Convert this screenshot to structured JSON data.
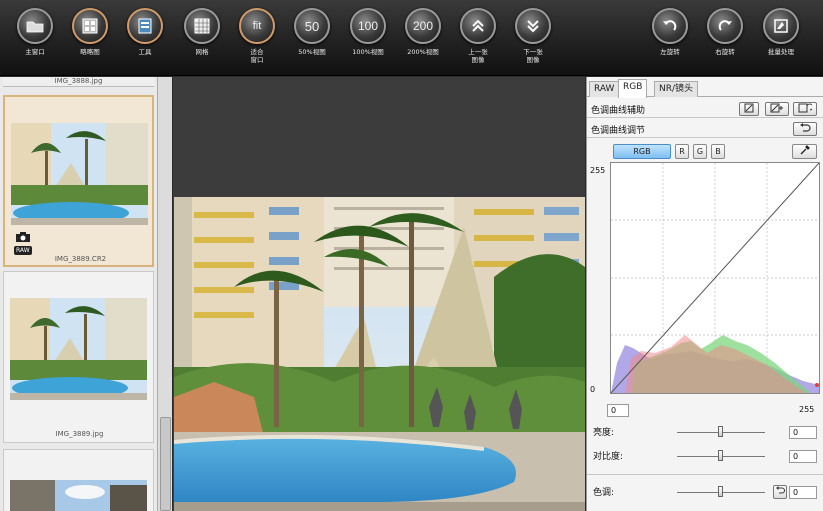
{
  "toolbar": {
    "buttons": [
      {
        "label": "主窗口",
        "glyph": ""
      },
      {
        "label": "略略图",
        "glyph": ""
      },
      {
        "label": "工具",
        "glyph": ""
      },
      {
        "label": "网格",
        "glyph": ""
      },
      {
        "label": "适合\n窗口",
        "glyph": "fit"
      },
      {
        "label": "50%视图",
        "glyph": "50"
      },
      {
        "label": "100%视图",
        "glyph": "100"
      },
      {
        "label": "200%视图",
        "glyph": "200"
      },
      {
        "label": "上一张\n图像",
        "glyph": ""
      },
      {
        "label": "下一张\n图像",
        "glyph": ""
      },
      {
        "label": "左旋转",
        "glyph": ""
      },
      {
        "label": "右旋转",
        "glyph": ""
      },
      {
        "label": "批量处理",
        "glyph": ""
      }
    ]
  },
  "thumbnails": {
    "top_caption": "IMG_3888.jpg",
    "items": [
      {
        "caption": "IMG_3889.CR2",
        "badge": "RAW"
      },
      {
        "caption": "IMG_3889.jpg",
        "badge": ""
      }
    ]
  },
  "panel": {
    "tabs": [
      "RAW",
      "RGB",
      "NR/镜头"
    ],
    "active_tab": "RGB",
    "curve_assist_title": "色调曲线辅助",
    "curve_adjust_title": "色调曲线调节",
    "channels": [
      "RGB",
      "R",
      "G",
      "B"
    ],
    "axis": {
      "y_max": "255",
      "y_min": "0",
      "x_min": "0",
      "x_max": "255"
    },
    "sliders": [
      {
        "label": "亮度:",
        "value": "0",
        "position": 0.5
      },
      {
        "label": "对比度:",
        "value": "0",
        "position": 0.5
      },
      {
        "label": "色调:",
        "value": "0",
        "position": 0.5
      }
    ]
  },
  "colors": {
    "selected_border": "#d9b37c",
    "active_channel": "#7fbff0"
  }
}
